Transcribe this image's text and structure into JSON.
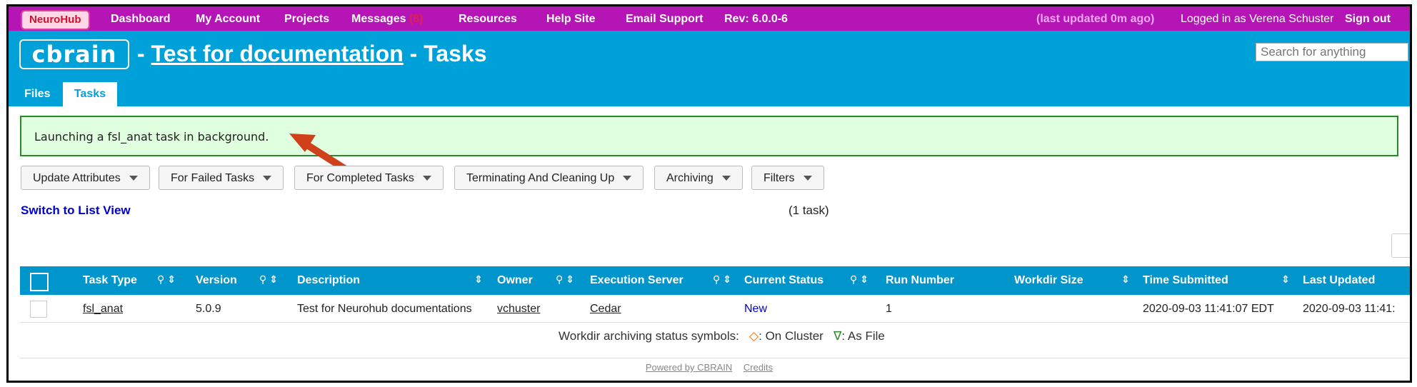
{
  "topbar": {
    "brand": "NeuroHub",
    "nav": [
      "Dashboard",
      "My Account",
      "Projects"
    ],
    "messages_label": "Messages",
    "messages_count": "(8)",
    "nav2": [
      "Resources",
      "Help Site",
      "Email Support"
    ],
    "revision": "Rev: 6.0.0-6",
    "last_updated": "(last updated 0m ago)",
    "logged_in": "Logged in as Verena Schuster",
    "sign_out": "Sign out"
  },
  "header": {
    "logo": "cbrain",
    "sep1": "-",
    "project": "Test for documentation",
    "sep2": "- Tasks",
    "search_placeholder": "Search for anything",
    "tabs": [
      "Files",
      "Tasks"
    ]
  },
  "flash": "Launching a fsl_anat task in background.",
  "toolbar": [
    "Update Attributes",
    "For Failed Tasks",
    "For Completed Tasks",
    "Terminating And Cleaning Up",
    "Archiving",
    "Filters"
  ],
  "switch_view": "Switch to List View",
  "task_count": "(1 task)",
  "table": {
    "headers": [
      "Task Type",
      "Version",
      "Description",
      "Owner",
      "Execution Server",
      "Current Status",
      "Run Number",
      "Workdir Size",
      "Time Submitted",
      "Last Updated"
    ],
    "rows": [
      [
        "fsl_anat",
        "5.0.9",
        "Test for Neurohub documentations",
        "vchuster",
        "Cedar",
        "New",
        "1",
        "",
        "2020-09-03 11:41:07 EDT",
        "2020-09-03 11:41:"
      ]
    ]
  },
  "legend": {
    "label": "Workdir archiving status symbols:",
    "on_cluster_symbol": "◇",
    "on_cluster": ": On Cluster",
    "as_file_symbol": "∇",
    "as_file": ": As File"
  },
  "footer": [
    "Powered by CBRAIN",
    "Credits"
  ],
  "colors": {
    "topbar": "#b515b5",
    "header": "#00a0d8",
    "flash_bg": "#dfffde",
    "table_header": "#0096cc",
    "arrow": "#d0401a"
  }
}
